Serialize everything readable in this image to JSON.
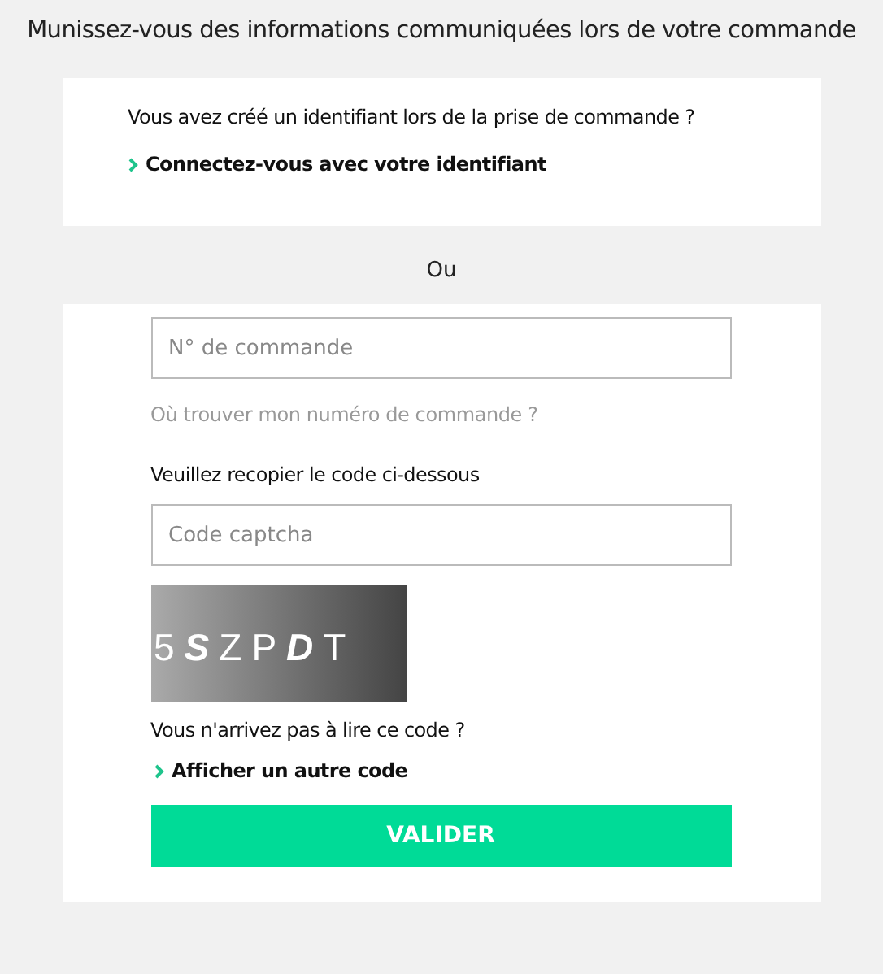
{
  "heading": "Munissez-vous des informations communiquées lors de votre commande",
  "account_card": {
    "question": "Vous avez créé un identifiant lors de la prise de commande ?",
    "link": "Connectez-vous avec votre identifiant"
  },
  "separator": "Ou",
  "order_form": {
    "order_field": {
      "placeholder": "N° de commande"
    },
    "help_link": "Où trouver mon numéro de commande ?",
    "captcha_label": "Veuillez recopier le code ci-dessous",
    "captcha_field": {
      "placeholder": "Code captcha"
    },
    "captcha_code": "5SZPDT",
    "captcha_question": "Vous n'arrivez pas à lire ce code ?",
    "captcha_link": "Afficher un autre code",
    "submit": "VALIDER"
  }
}
